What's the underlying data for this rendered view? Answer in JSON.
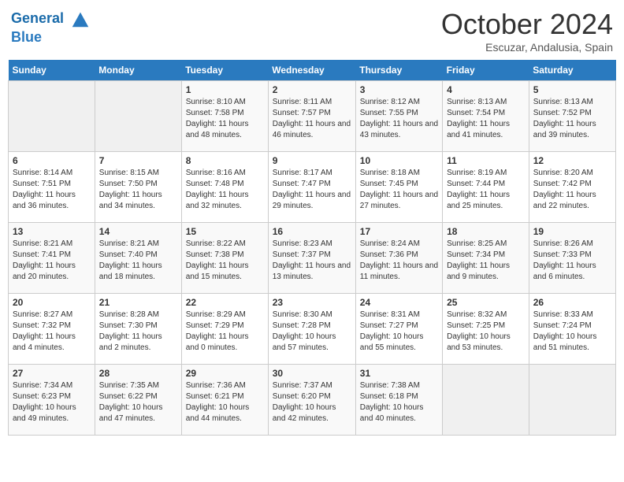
{
  "logo": {
    "line1": "General",
    "line2": "Blue"
  },
  "title": "October 2024",
  "subtitle": "Escuzar, Andalusia, Spain",
  "days_of_week": [
    "Sunday",
    "Monday",
    "Tuesday",
    "Wednesday",
    "Thursday",
    "Friday",
    "Saturday"
  ],
  "weeks": [
    [
      {
        "day": "",
        "info": ""
      },
      {
        "day": "",
        "info": ""
      },
      {
        "day": "1",
        "info": "Sunrise: 8:10 AM\nSunset: 7:58 PM\nDaylight: 11 hours and 48 minutes."
      },
      {
        "day": "2",
        "info": "Sunrise: 8:11 AM\nSunset: 7:57 PM\nDaylight: 11 hours and 46 minutes."
      },
      {
        "day": "3",
        "info": "Sunrise: 8:12 AM\nSunset: 7:55 PM\nDaylight: 11 hours and 43 minutes."
      },
      {
        "day": "4",
        "info": "Sunrise: 8:13 AM\nSunset: 7:54 PM\nDaylight: 11 hours and 41 minutes."
      },
      {
        "day": "5",
        "info": "Sunrise: 8:13 AM\nSunset: 7:52 PM\nDaylight: 11 hours and 39 minutes."
      }
    ],
    [
      {
        "day": "6",
        "info": "Sunrise: 8:14 AM\nSunset: 7:51 PM\nDaylight: 11 hours and 36 minutes."
      },
      {
        "day": "7",
        "info": "Sunrise: 8:15 AM\nSunset: 7:50 PM\nDaylight: 11 hours and 34 minutes."
      },
      {
        "day": "8",
        "info": "Sunrise: 8:16 AM\nSunset: 7:48 PM\nDaylight: 11 hours and 32 minutes."
      },
      {
        "day": "9",
        "info": "Sunrise: 8:17 AM\nSunset: 7:47 PM\nDaylight: 11 hours and 29 minutes."
      },
      {
        "day": "10",
        "info": "Sunrise: 8:18 AM\nSunset: 7:45 PM\nDaylight: 11 hours and 27 minutes."
      },
      {
        "day": "11",
        "info": "Sunrise: 8:19 AM\nSunset: 7:44 PM\nDaylight: 11 hours and 25 minutes."
      },
      {
        "day": "12",
        "info": "Sunrise: 8:20 AM\nSunset: 7:42 PM\nDaylight: 11 hours and 22 minutes."
      }
    ],
    [
      {
        "day": "13",
        "info": "Sunrise: 8:21 AM\nSunset: 7:41 PM\nDaylight: 11 hours and 20 minutes."
      },
      {
        "day": "14",
        "info": "Sunrise: 8:21 AM\nSunset: 7:40 PM\nDaylight: 11 hours and 18 minutes."
      },
      {
        "day": "15",
        "info": "Sunrise: 8:22 AM\nSunset: 7:38 PM\nDaylight: 11 hours and 15 minutes."
      },
      {
        "day": "16",
        "info": "Sunrise: 8:23 AM\nSunset: 7:37 PM\nDaylight: 11 hours and 13 minutes."
      },
      {
        "day": "17",
        "info": "Sunrise: 8:24 AM\nSunset: 7:36 PM\nDaylight: 11 hours and 11 minutes."
      },
      {
        "day": "18",
        "info": "Sunrise: 8:25 AM\nSunset: 7:34 PM\nDaylight: 11 hours and 9 minutes."
      },
      {
        "day": "19",
        "info": "Sunrise: 8:26 AM\nSunset: 7:33 PM\nDaylight: 11 hours and 6 minutes."
      }
    ],
    [
      {
        "day": "20",
        "info": "Sunrise: 8:27 AM\nSunset: 7:32 PM\nDaylight: 11 hours and 4 minutes."
      },
      {
        "day": "21",
        "info": "Sunrise: 8:28 AM\nSunset: 7:30 PM\nDaylight: 11 hours and 2 minutes."
      },
      {
        "day": "22",
        "info": "Sunrise: 8:29 AM\nSunset: 7:29 PM\nDaylight: 11 hours and 0 minutes."
      },
      {
        "day": "23",
        "info": "Sunrise: 8:30 AM\nSunset: 7:28 PM\nDaylight: 10 hours and 57 minutes."
      },
      {
        "day": "24",
        "info": "Sunrise: 8:31 AM\nSunset: 7:27 PM\nDaylight: 10 hours and 55 minutes."
      },
      {
        "day": "25",
        "info": "Sunrise: 8:32 AM\nSunset: 7:25 PM\nDaylight: 10 hours and 53 minutes."
      },
      {
        "day": "26",
        "info": "Sunrise: 8:33 AM\nSunset: 7:24 PM\nDaylight: 10 hours and 51 minutes."
      }
    ],
    [
      {
        "day": "27",
        "info": "Sunrise: 7:34 AM\nSunset: 6:23 PM\nDaylight: 10 hours and 49 minutes."
      },
      {
        "day": "28",
        "info": "Sunrise: 7:35 AM\nSunset: 6:22 PM\nDaylight: 10 hours and 47 minutes."
      },
      {
        "day": "29",
        "info": "Sunrise: 7:36 AM\nSunset: 6:21 PM\nDaylight: 10 hours and 44 minutes."
      },
      {
        "day": "30",
        "info": "Sunrise: 7:37 AM\nSunset: 6:20 PM\nDaylight: 10 hours and 42 minutes."
      },
      {
        "day": "31",
        "info": "Sunrise: 7:38 AM\nSunset: 6:18 PM\nDaylight: 10 hours and 40 minutes."
      },
      {
        "day": "",
        "info": ""
      },
      {
        "day": "",
        "info": ""
      }
    ]
  ]
}
